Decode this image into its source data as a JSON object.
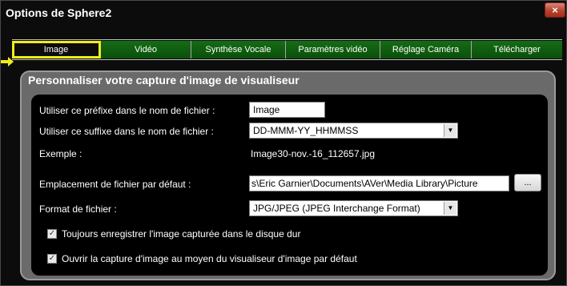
{
  "window": {
    "title": "Options de Sphere2",
    "close_glyph": "×"
  },
  "tabs": [
    {
      "label": "Image",
      "active": true
    },
    {
      "label": "Vidéo",
      "active": false
    },
    {
      "label": "Synthèse Vocale",
      "active": false
    },
    {
      "label": "Paramètres vidéo",
      "active": false
    },
    {
      "label": "Réglage Caméra",
      "active": false
    },
    {
      "label": "Télécharger",
      "active": false
    }
  ],
  "panel": {
    "title": "Personnaliser votre capture d'image de visualiseur",
    "prefix": {
      "label": "Utiliser ce préfixe dans le nom de fichier :",
      "value": "Image"
    },
    "suffix": {
      "label": "Utiliser ce suffixe dans le nom de fichier :",
      "value": "DD-MMM-YY_HHMMSS"
    },
    "example": {
      "label": "Exemple :",
      "value": "Image30-nov.-16_112657.jpg"
    },
    "location": {
      "label": "Emplacement de fichier par défaut :",
      "value": "s\\Eric Garnier\\Documents\\AVer\\Media Library\\Picture",
      "browse_label": "..."
    },
    "format": {
      "label": "Format de fichier :",
      "value": "JPG/JPEG (JPEG Interchange Format)"
    },
    "checkboxes": [
      {
        "label": "Toujours enregistrer l'image capturée dans le disque dur",
        "checked": true
      },
      {
        "label": "Ouvrir la capture d'image au moyen du visualiseur d'image par défaut",
        "checked": true
      }
    ]
  },
  "colors": {
    "tab_green": "#156c15",
    "highlight_yellow": "#f0eb1e",
    "panel_gray": "#6a6a6a"
  },
  "icons": {
    "close": "close-icon",
    "dropdown": "chevron-down-icon",
    "checkbox": "checkbox-checked-icon",
    "annotation": "yellow-arrow-icon"
  }
}
